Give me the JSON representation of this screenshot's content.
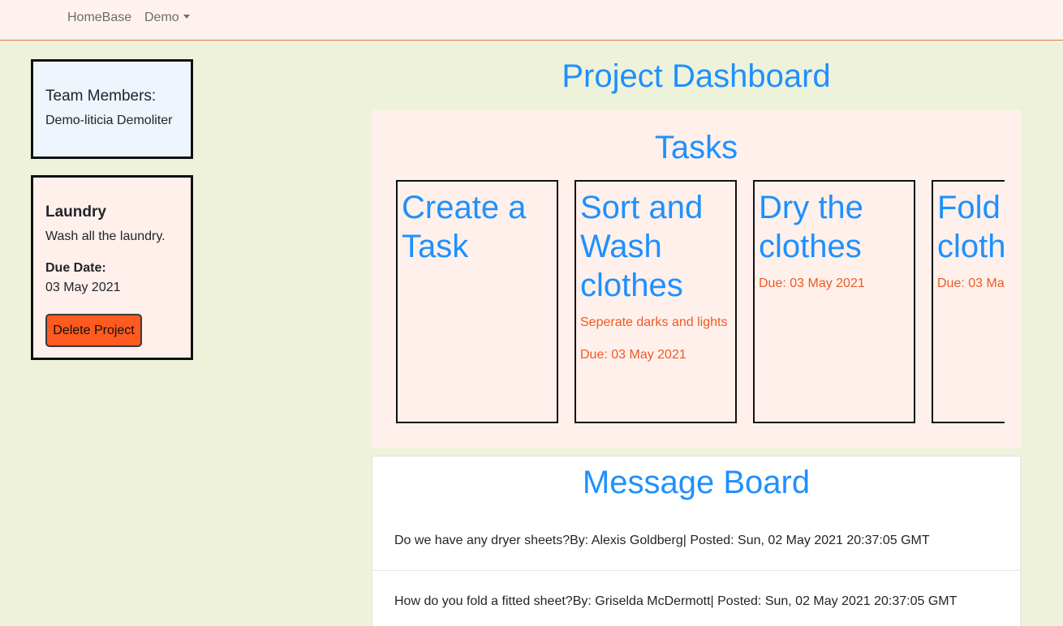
{
  "navbar": {
    "brand": "HomeBase",
    "demo_menu": "Demo"
  },
  "team": {
    "title": "Team Members:",
    "members": [
      "Demo-liticia Demoliter"
    ]
  },
  "project": {
    "title": "Laundry",
    "description": "Wash all the laundry.",
    "due_label": "Due Date:",
    "due_value": "03 May 2021",
    "delete_label": "Delete Project"
  },
  "dashboard": {
    "title": "Project Dashboard"
  },
  "tasks": {
    "title": "Tasks",
    "items": [
      {
        "title": "Create a\nTask",
        "description": "",
        "due": ""
      },
      {
        "title": "Sort and\nWash\nclothes",
        "description": "Seperate darks and lights",
        "due": "Due: 03 May 2021"
      },
      {
        "title": "Dry the\nclothes",
        "description": "",
        "due": "Due: 03 May 2021"
      },
      {
        "title": "Fold\ncloth",
        "description": "",
        "due": "Due: 03 Ma"
      }
    ]
  },
  "messages": {
    "title": "Message Board",
    "items": [
      {
        "text": "Do we have any dryer sheets?",
        "by": "By: Alexis Goldberg",
        "posted": "| Posted: Sun, 02 May 2021 20:37:05 GMT"
      },
      {
        "text": "How do you fold a fitted sheet?",
        "by": "By: Griselda McDermott",
        "posted": "| Posted: Sun, 02 May 2021 20:37:05 GMT"
      }
    ]
  },
  "colors": {
    "accent": "#1e90ff",
    "due": "#ee5a24",
    "danger_button": "#ff5a1f",
    "background": "#eff2da",
    "panel": "#fff0ec"
  }
}
